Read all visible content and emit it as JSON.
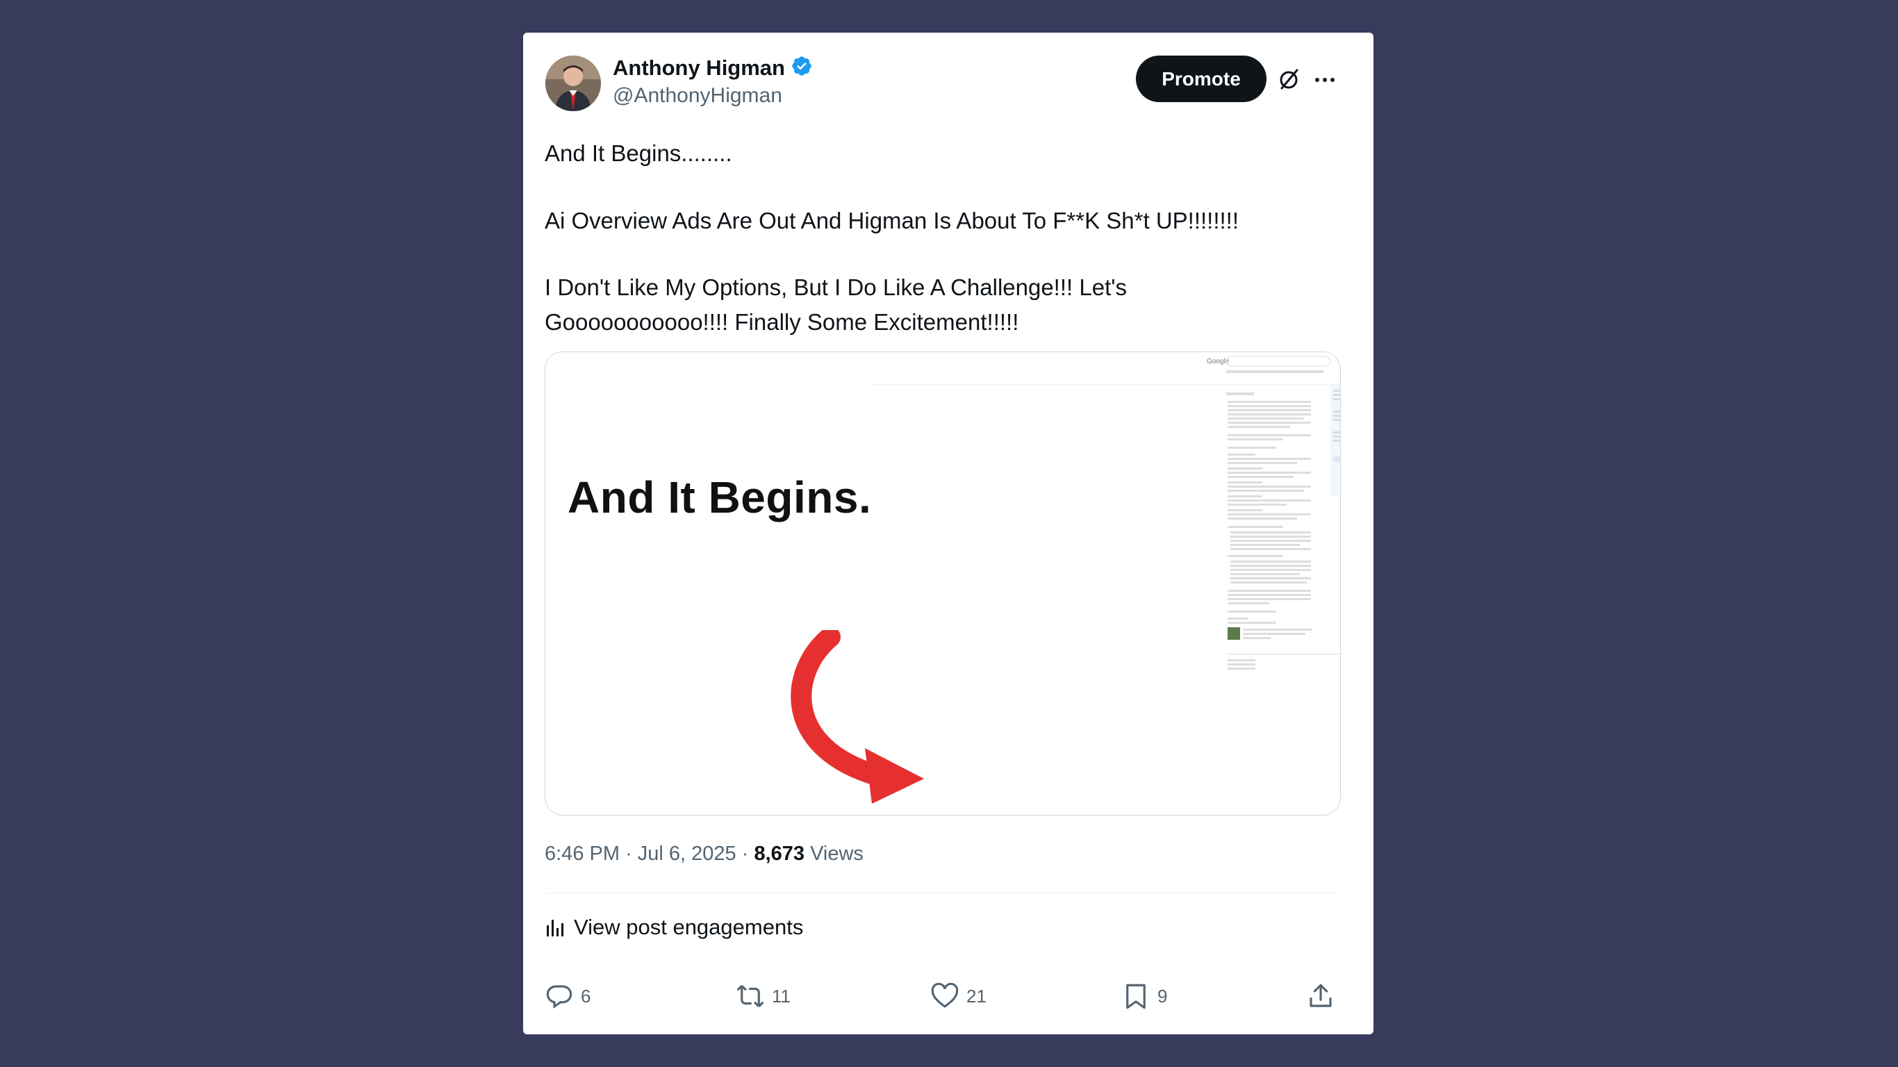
{
  "author": {
    "display_name": "Anthony Higman",
    "handle": "@AnthonyHigman",
    "verified": true
  },
  "header": {
    "promote_label": "Promote"
  },
  "post": {
    "line1": "And It Begins........",
    "line2": "Ai Overview Ads Are Out And Higman Is About To F**K Sh*t UP!!!!!!!!",
    "line3a": "I Don't Like My Options, But I Do Like A Challenge!!! Let's",
    "line3b": "Gooooooooooo!!!! Finally Some Excitement!!!!!"
  },
  "media": {
    "headline": "And It Begins....",
    "serp_logo": "Google",
    "arrow_color": "#e63030"
  },
  "meta": {
    "time": "6:46 PM",
    "date": "Jul 6, 2025",
    "views_count": "8,673",
    "views_label": "Views"
  },
  "engagements_label": "View post engagements",
  "actions": {
    "replies": "6",
    "reposts": "11",
    "likes": "21",
    "bookmarks": "9"
  },
  "colors": {
    "background": "#393b5d",
    "card": "#ffffff",
    "verified": "#1d9bf0",
    "promote_bg": "#0f1419",
    "secondary_text": "#536471"
  }
}
